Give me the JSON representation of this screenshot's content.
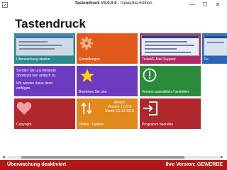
{
  "window": {
    "title_bold": "Tastendruck V1.0.0.0",
    "title_rest": " - Gewerbe-Edition",
    "minimize": "—",
    "maximize": "☐",
    "close": "✕"
  },
  "app": {
    "heading": "Tastendruck"
  },
  "tiles": {
    "ueberwachung": {
      "label": "Überwachung starten",
      "icon": "screen-preview-image"
    },
    "einstellungen": {
      "label": "Einstellungen",
      "icon": "gear-icon"
    },
    "support": {
      "label": "Ticket/E-Mail Support",
      "icon": "screen-preview-image"
    },
    "feedback": {
      "label": "Fe",
      "icon": "screen-preview-image"
    },
    "shortcut": {
      "line1": "Senden Sie uns fehlende",
      "line2": "Shortcuts hier einfach zu.",
      "line3": "Wir werden diese dann",
      "line4": "einfügen."
    },
    "bewerten": {
      "label": "Bewerten Sie uns",
      "icon": "star-icon"
    },
    "version": {
      "label": "Version auswählen / bestellen",
      "icon": "exclamation-circle-icon"
    },
    "copyright": {
      "label": "Copyright",
      "icon": "heart-icon"
    },
    "update": {
      "label": "Online - Update",
      "line1": "Aktuell:",
      "line2": "Version 1.0.0.0",
      "line3": "Stand: 01.12.2015",
      "icon": "sort-arrows-icon"
    },
    "beenden": {
      "label": "Programm beenden",
      "icon": "exit-door-icon"
    }
  },
  "status": {
    "left": "Überwachung deaktiviert",
    "right": "Ihre Version: GEWERBE"
  },
  "colors": {
    "teal": "#2a8a8e",
    "orange": "#e05a1e",
    "magenta": "#b02a66",
    "blue": "#2a66b8",
    "purple": "#6c3bbf",
    "green": "#2a8a3c",
    "red": "#b0282e",
    "amber": "#e08a1e",
    "statusbar": "#b01818"
  }
}
